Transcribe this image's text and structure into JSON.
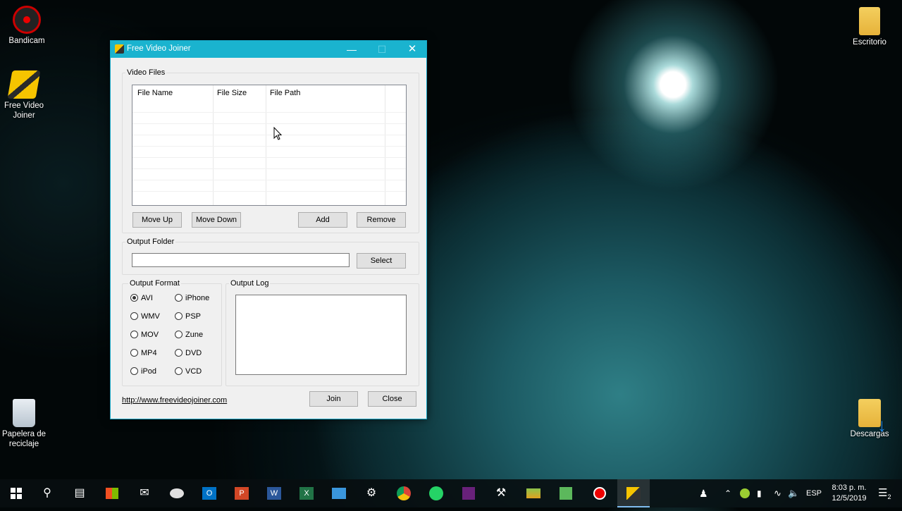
{
  "desktop": {
    "icons": [
      {
        "label": "Bandicam"
      },
      {
        "label": "Free Video Joiner"
      },
      {
        "label": "Papelera de reciclaje"
      },
      {
        "label": "Escritorio"
      },
      {
        "label": "Descargas"
      }
    ]
  },
  "window": {
    "title": "Free Video Joiner",
    "video_files": {
      "group_label": "Video Files",
      "columns": [
        "File Name",
        "File Size",
        "File Path"
      ],
      "buttons": {
        "move_up": "Move Up",
        "move_down": "Move Down",
        "add": "Add",
        "remove": "Remove"
      }
    },
    "output_folder": {
      "group_label": "Output Folder",
      "value": "",
      "select_label": "Select"
    },
    "output_format": {
      "group_label": "Output Format",
      "options": [
        "AVI",
        "WMV",
        "MOV",
        "MP4",
        "iPod",
        "iPhone",
        "PSP",
        "Zune",
        "DVD",
        "VCD"
      ],
      "selected": "AVI"
    },
    "output_log": {
      "group_label": "Output Log"
    },
    "link": "http://www.freevideojoiner.com",
    "join_label": "Join",
    "close_label": "Close"
  },
  "taskbar": {
    "language": "ESP",
    "time": "8:03 p. m.",
    "date": "12/5/2019",
    "notifications": "2",
    "apps": [
      "start-icon",
      "search-icon",
      "task-view-icon",
      "store-icon",
      "mail-icon",
      "paint-icon",
      "outlook-icon",
      "powerpoint-icon",
      "word-icon",
      "excel-icon",
      "remote-desktop-icon",
      "settings-icon",
      "chrome-icon",
      "whatsapp-icon",
      "visual-studio-icon",
      "tools-icon",
      "stack-icon",
      "media-icon",
      "bandicam-record-icon",
      "free-video-joiner-icon"
    ]
  }
}
